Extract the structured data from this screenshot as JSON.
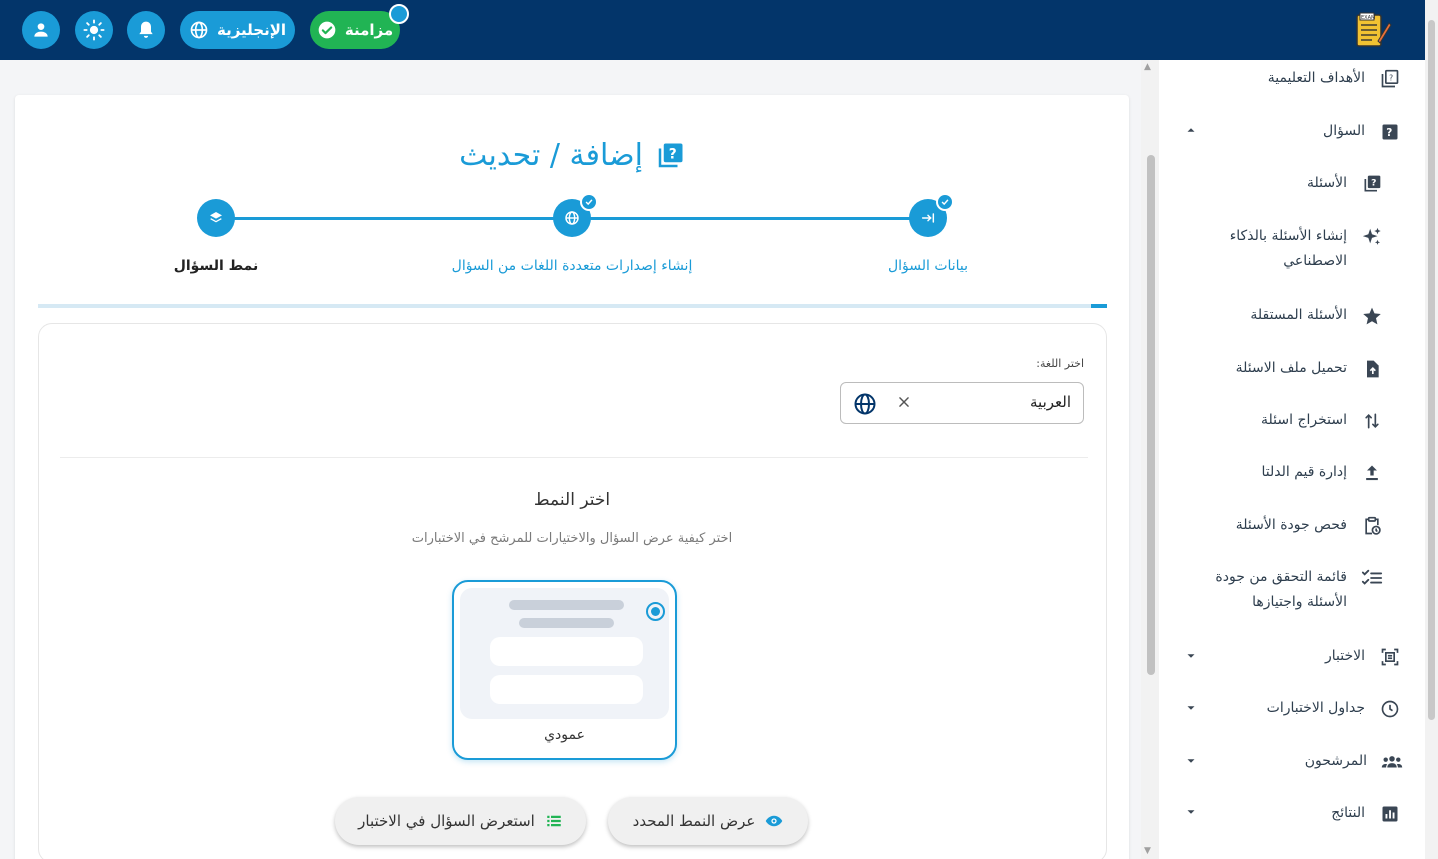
{
  "header": {
    "language_button": "الإنجليزية",
    "sync_button": "مزامنة"
  },
  "sidebar": {
    "items": [
      {
        "label": "الأهداف التعليمية",
        "icon": "book-help-icon"
      },
      {
        "label": "السؤال",
        "icon": "question-box-icon",
        "expanded": true
      },
      {
        "label": "الأسئلة",
        "icon": "question-book-icon"
      },
      {
        "label": "إنشاء الأسئلة بالذكاء الاصطناعي",
        "icon": "sparkle-icon"
      },
      {
        "label": "الأسئلة المستقلة",
        "icon": "star-icon"
      },
      {
        "label": "تحميل ملف الاسئلة",
        "icon": "file-upload-icon"
      },
      {
        "label": "استخراج اسئلة",
        "icon": "swap-vertical-icon"
      },
      {
        "label": "إدارة قيم الدلتا",
        "icon": "upload-icon"
      },
      {
        "label": "فحص جودة الأسئلة",
        "icon": "clipboard-clock-icon"
      },
      {
        "label": "قائمة التحقق من جودة الأسئلة واجتيازها",
        "icon": "checklist-icon"
      },
      {
        "label": "الاختبار",
        "icon": "exam-frame-icon",
        "expanded": false
      },
      {
        "label": "جداول الاختبارات",
        "icon": "clock-icon",
        "expanded": false
      },
      {
        "label": "المرشحون",
        "icon": "people-icon",
        "expanded": false
      },
      {
        "label": "النتائج",
        "icon": "bar-chart-icon",
        "expanded": false
      }
    ]
  },
  "main": {
    "title": "إضافة / تحديث",
    "steps": [
      {
        "label": "بيانات السؤال",
        "icon": "login-arrow-icon",
        "done": true
      },
      {
        "label": "إنشاء إصدارات متعددة اللغات من السؤال",
        "icon": "globe-icon",
        "done": true
      },
      {
        "label": "نمط السؤال",
        "icon": "layers-icon",
        "done": false,
        "active": true
      }
    ],
    "progress_percent": 1.5,
    "language_label": "اختر اللغة:",
    "language_value": "العربية",
    "layout_title": "اختر النمط",
    "layout_subtitle": "اختر كيفية عرض السؤال والاختيارات للمرشح في الاختبارات",
    "layout_option": "عمودي",
    "preview_layout_button": "عرض النمط المحدد",
    "preview_question_button": "استعرض السؤال في الاختبار"
  },
  "colors": {
    "header": "#03356a",
    "accent": "#1a9bd7",
    "sync": "#21b454"
  }
}
